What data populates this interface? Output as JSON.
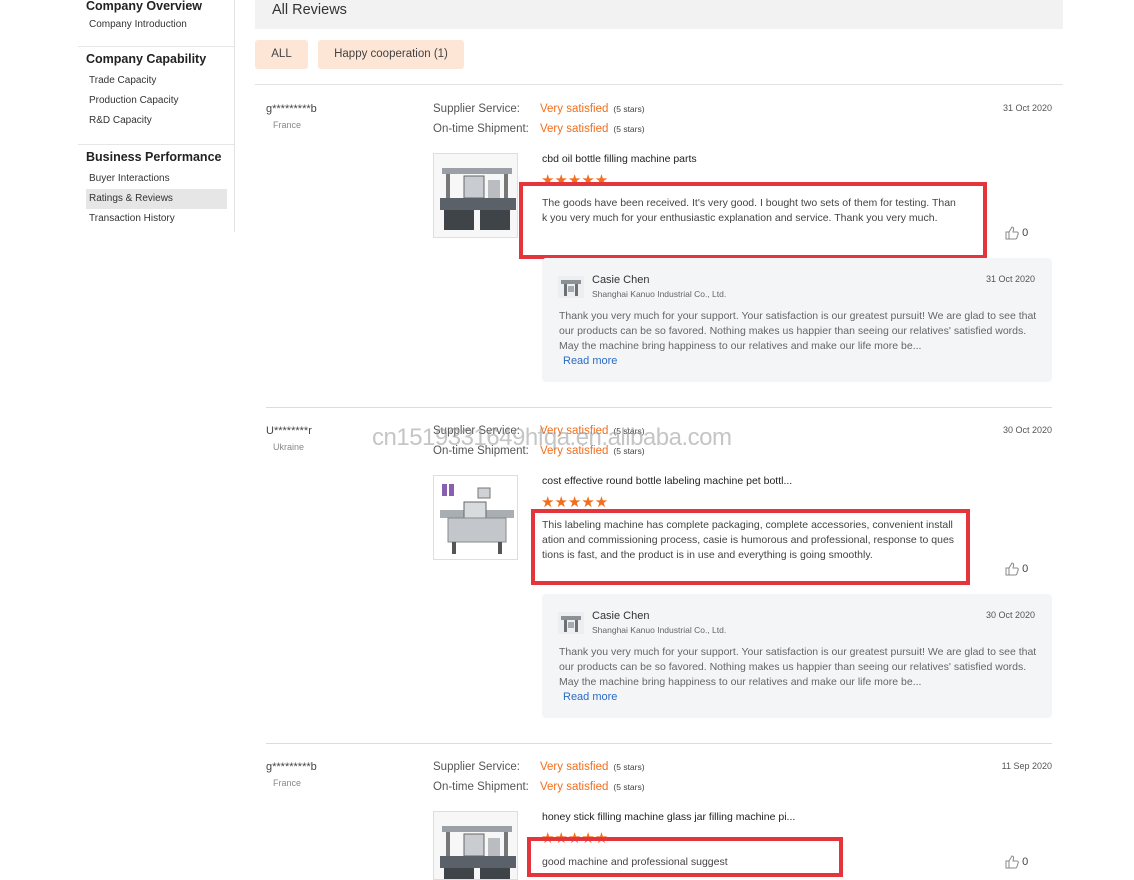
{
  "sidebar": {
    "groups": [
      {
        "title": "Company Overview",
        "items": [
          "Company Introduction"
        ]
      },
      {
        "title": "Company Capability",
        "items": [
          "Trade Capacity",
          "Production Capacity",
          "R&D Capacity"
        ]
      },
      {
        "title": "Business Performance",
        "items": [
          "Buyer Interactions",
          "Ratings & Reviews",
          "Transaction History"
        ]
      }
    ],
    "active_item": "Ratings & Reviews"
  },
  "header": {
    "title": "All Reviews"
  },
  "filters": {
    "all": "ALL",
    "happy": "Happy cooperation (1)"
  },
  "labels": {
    "supplier_service": "Supplier Service:",
    "on_time_shipment": "On-time Shipment:",
    "read_more": "Read more"
  },
  "colors": {
    "accent": "#f26e1d",
    "highlight": "#e3353b",
    "link": "#2b6cc4",
    "filter_bg": "#fde6d6"
  },
  "reviews": [
    {
      "buyer": "g*********b",
      "country": "France",
      "date": "31 Oct 2020",
      "supplier_service": "Very satisfied",
      "supplier_stars": "(5 stars)",
      "shipment": "Very satisfied",
      "shipment_stars": "(5 stars)",
      "product_title": "cbd oil bottle filling machine parts",
      "stars": "★★★★★",
      "text": "The goods have been received. It's very good. I bought two sets of them for testing. Thank you very much for your enthusiastic explanation and service. Thank you very much.",
      "likes": "0",
      "reply": {
        "name": "Casie Chen",
        "company": "Shanghai Kanuo Industrial Co., Ltd.",
        "date": "31 Oct 2020",
        "text": "Thank you very much for your support. Your satisfaction is our greatest pursuit! We are glad to see that our products can be so favored. Nothing makes us happier than seeing our relatives' satisfied words. May the machine bring happiness to our relatives and make our life more be..."
      }
    },
    {
      "buyer": "U********r",
      "country": "Ukraine",
      "date": "30 Oct 2020",
      "supplier_service": "Very satisfied",
      "supplier_stars": "(5 stars)",
      "shipment": "Very satisfied",
      "shipment_stars": "(5 stars)",
      "product_title": "cost effective round bottle labeling machine pet bottl...",
      "stars": "★★★★★",
      "text": "This labeling machine has complete packaging, complete accessories, convenient installation and commissioning process, casie is humorous and professional, response to questions is fast, and the product is in use and everything is going smoothly.",
      "likes": "0",
      "reply": {
        "name": "Casie Chen",
        "company": "Shanghai Kanuo Industrial Co., Ltd.",
        "date": "30 Oct 2020",
        "text": "Thank you very much for your support. Your satisfaction is our greatest pursuit! We are glad to see that our products can be so favored. Nothing makes us happier than seeing our relatives' satisfied words. May the machine bring happiness to our relatives and make our life more be..."
      }
    },
    {
      "buyer": "g*********b",
      "country": "France",
      "date": "11 Sep 2020",
      "supplier_service": "Very satisfied",
      "supplier_stars": "(5 stars)",
      "shipment": "Very satisfied",
      "shipment_stars": "(5 stars)",
      "product_title": "honey stick filling machine glass jar filling machine pi...",
      "stars": "★★★★★",
      "text": "good machine and professional suggest",
      "likes": "0"
    }
  ],
  "watermark": "cn1519331649hfqa.en.alibaba.com"
}
